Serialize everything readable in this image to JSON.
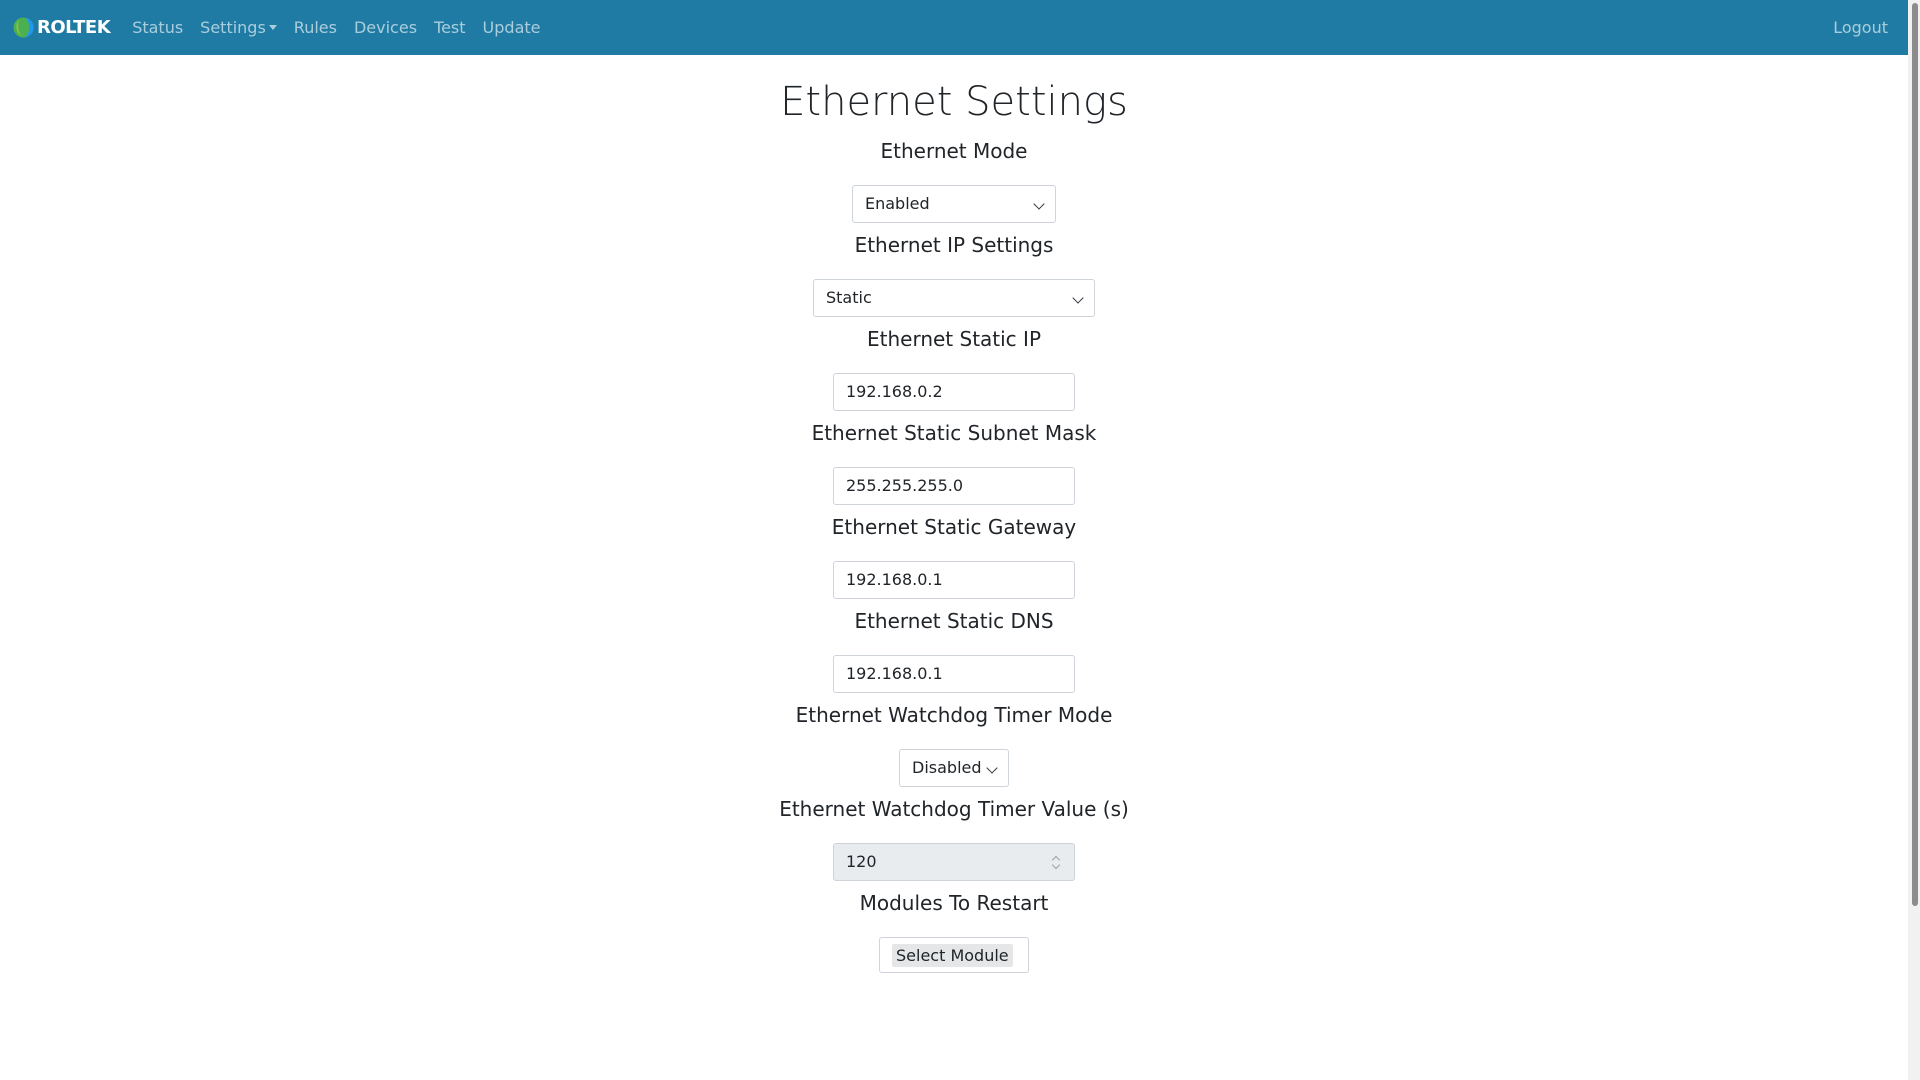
{
  "navbar": {
    "brand": "ROLTEK",
    "links": [
      "Status",
      "Settings",
      "Rules",
      "Devices",
      "Test",
      "Update"
    ],
    "logout": "Logout",
    "accent_color": "#1f7ba3"
  },
  "page": {
    "title": "Ethernet Settings"
  },
  "fields": {
    "ethernet_mode": {
      "label": "Ethernet Mode",
      "value": "Enabled"
    },
    "ip_settings": {
      "label": "Ethernet IP Settings",
      "value": "Static"
    },
    "static_ip": {
      "label": "Ethernet Static IP",
      "value": "192.168.0.2"
    },
    "subnet_mask": {
      "label": "Ethernet Static Subnet Mask",
      "value": "255.255.255.0"
    },
    "gateway": {
      "label": "Ethernet Static Gateway",
      "value": "192.168.0.1"
    },
    "dns": {
      "label": "Ethernet Static DNS",
      "value": "192.168.0.1"
    },
    "watchdog_mode": {
      "label": "Ethernet Watchdog Timer Mode",
      "value": "Disabled"
    },
    "watchdog_value": {
      "label": "Ethernet Watchdog Timer Value (s)",
      "value": "120"
    },
    "modules_restart": {
      "label": "Modules To Restart",
      "value": "Select Module"
    }
  }
}
